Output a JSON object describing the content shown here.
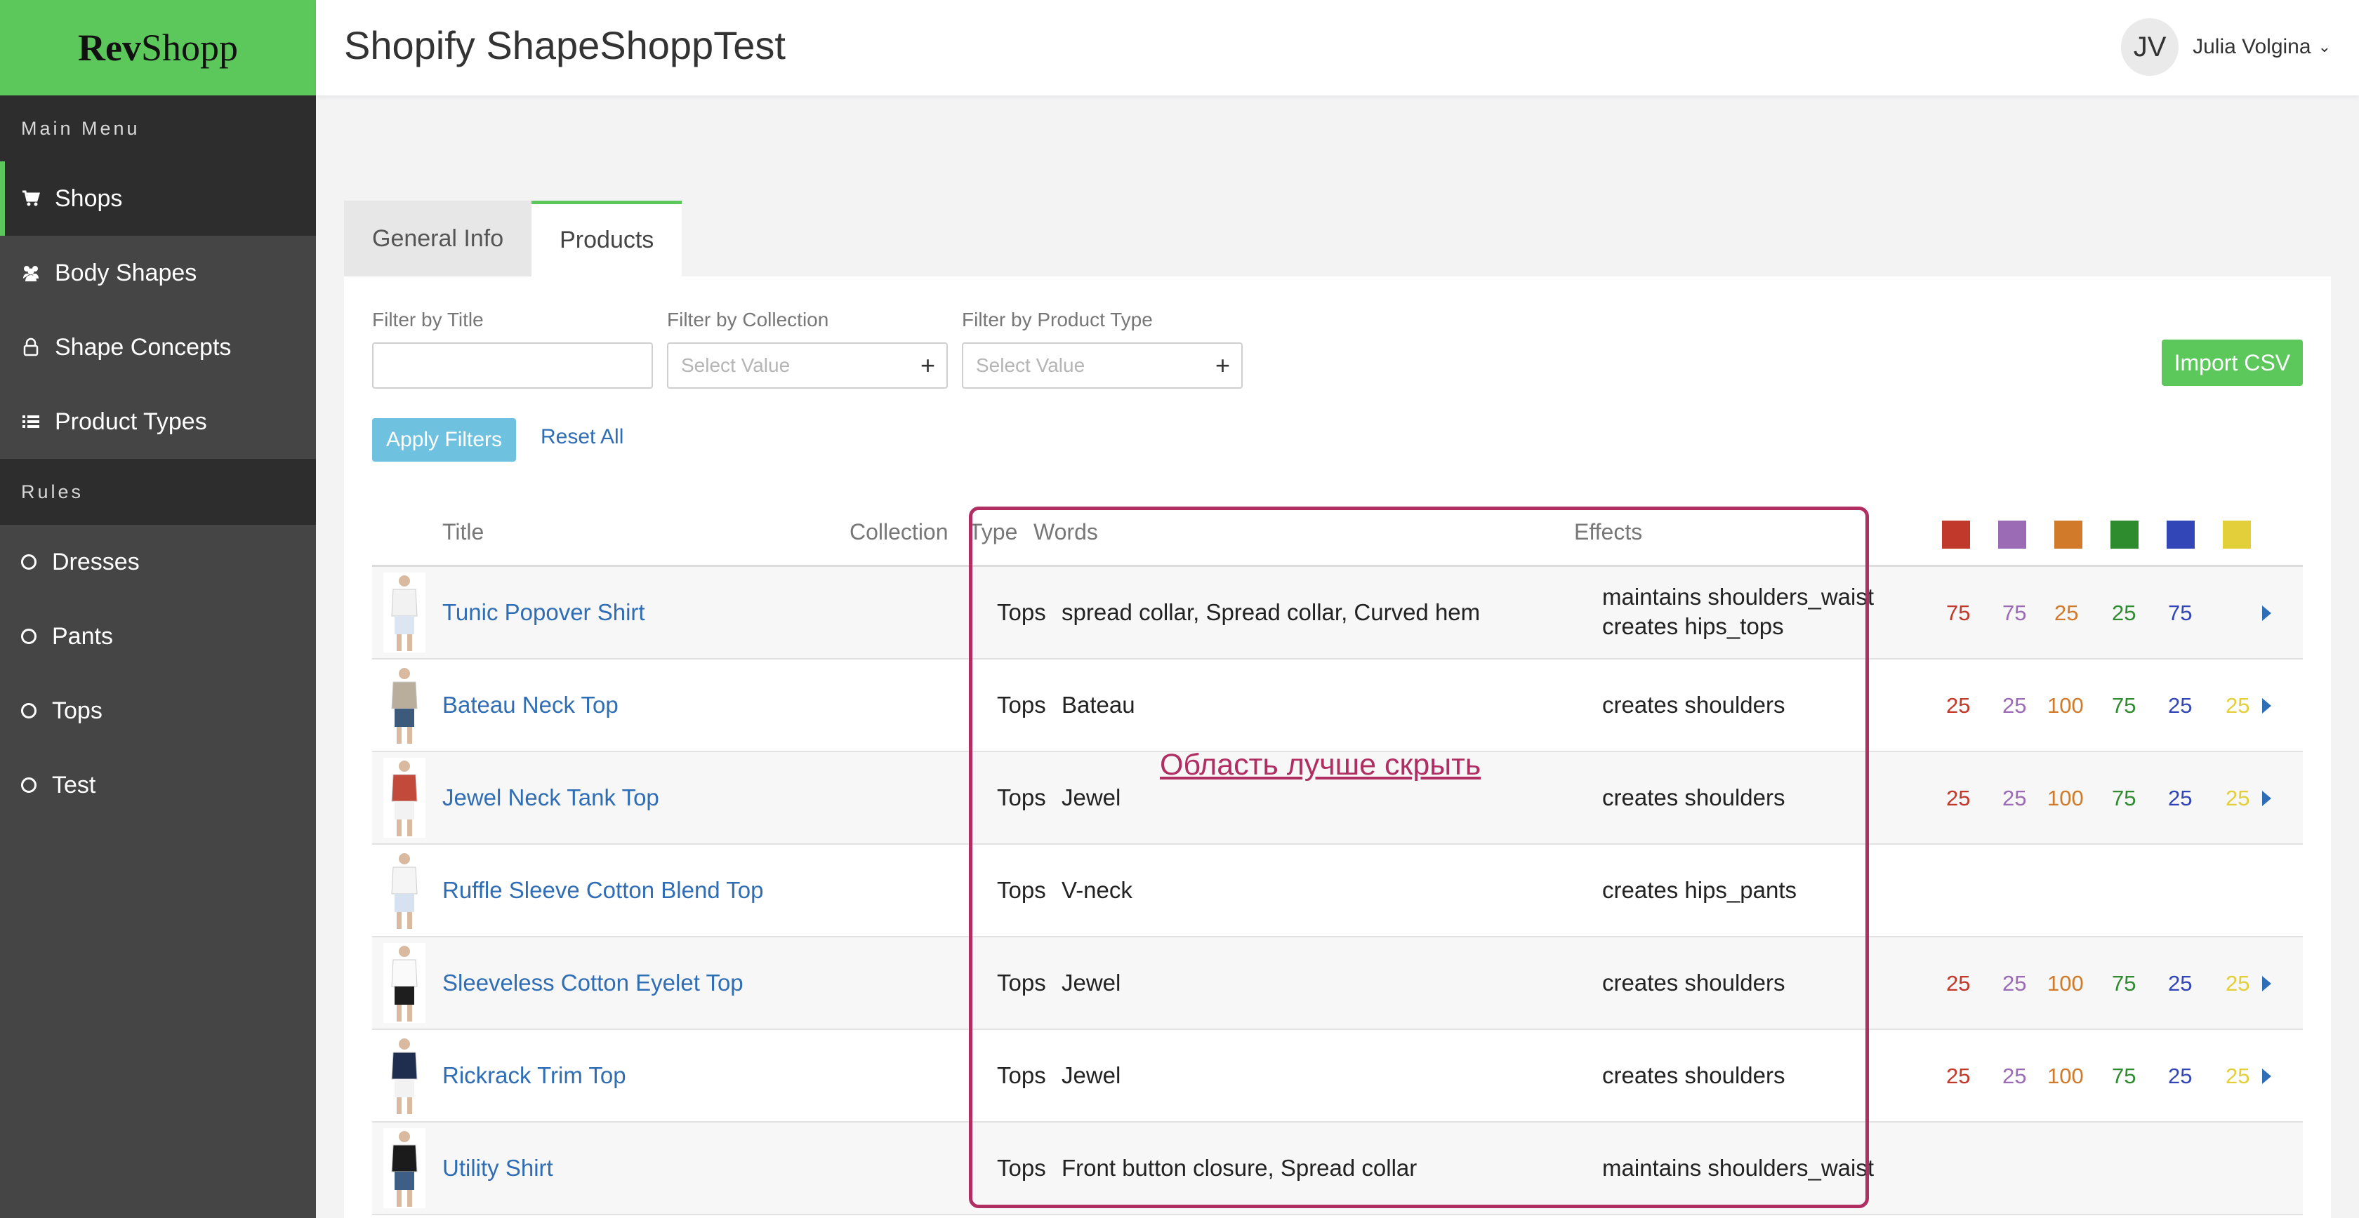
{
  "app": {
    "logo_bold": "Rev",
    "logo_light": "Shopp"
  },
  "header": {
    "title": "Shopify ShapeShoppTest",
    "user_initials": "JV",
    "user_name": "Julia Volgina"
  },
  "sidebar": {
    "main_menu_label": "Main Menu",
    "main_items": [
      {
        "label": "Shops",
        "icon": "cart-icon",
        "active": true
      },
      {
        "label": "Body Shapes",
        "icon": "users-icon",
        "active": false
      },
      {
        "label": "Shape Concepts",
        "icon": "lock-icon",
        "active": false
      },
      {
        "label": "Product Types",
        "icon": "list-icon",
        "active": false
      }
    ],
    "rules_label": "Rules",
    "rule_items": [
      {
        "label": "Dresses"
      },
      {
        "label": "Pants"
      },
      {
        "label": "Tops"
      },
      {
        "label": "Test"
      }
    ]
  },
  "tabs": [
    {
      "label": "General Info",
      "active": false
    },
    {
      "label": "Products",
      "active": true
    }
  ],
  "filters": {
    "title_label": "Filter by Title",
    "title_value": "",
    "collection_label": "Filter by Collection",
    "collection_placeholder": "Select Value",
    "type_label": "Filter by Product Type",
    "type_placeholder": "Select Value",
    "apply_label": "Apply Filters",
    "reset_label": "Reset All",
    "import_label": "Import CSV"
  },
  "table": {
    "headers": {
      "title": "Title",
      "collection": "Collection",
      "type": "Type",
      "words": "Words",
      "effects": "Effects"
    },
    "score_colors": [
      "#c0392b",
      "#9b6bb5",
      "#d07a2a",
      "#2e8b2e",
      "#3346b8",
      "#e2cf3a"
    ],
    "rows": [
      {
        "title": "Tunic Popover Shirt",
        "type": "Tops",
        "words": "spread collar, Spread collar, Curved hem",
        "effects": [
          "maintains shoulders_waist",
          "creates hips_tops"
        ],
        "scores": [
          "75",
          "75",
          "25",
          "25",
          "75",
          ""
        ],
        "arrow": true,
        "thumb": "white-shirt"
      },
      {
        "title": "Bateau Neck Top",
        "type": "Tops",
        "words": "Bateau",
        "effects": [
          "creates shoulders"
        ],
        "scores": [
          "25",
          "25",
          "100",
          "75",
          "25",
          "25"
        ],
        "arrow": true,
        "thumb": "striped-top"
      },
      {
        "title": "Jewel Neck Tank Top",
        "type": "Tops",
        "words": "Jewel",
        "effects": [
          "creates shoulders"
        ],
        "scores": [
          "25",
          "25",
          "100",
          "75",
          "25",
          "25"
        ],
        "arrow": true,
        "thumb": "tank-top"
      },
      {
        "title": "Ruffle Sleeve Cotton Blend Top",
        "type": "Tops",
        "words": "V-neck",
        "effects": [
          "creates hips_pants"
        ],
        "scores": [
          "",
          "",
          "",
          "",
          "",
          ""
        ],
        "arrow": false,
        "thumb": "white-top"
      },
      {
        "title": "Sleeveless Cotton Eyelet Top",
        "type": "Tops",
        "words": "Jewel",
        "effects": [
          "creates shoulders"
        ],
        "scores": [
          "25",
          "25",
          "100",
          "75",
          "25",
          "25"
        ],
        "arrow": true,
        "thumb": "eyelet-top"
      },
      {
        "title": "Rickrack Trim Top",
        "type": "Tops",
        "words": "Jewel",
        "effects": [
          "creates shoulders"
        ],
        "scores": [
          "25",
          "25",
          "100",
          "75",
          "25",
          "25"
        ],
        "arrow": true,
        "thumb": "navy-top"
      },
      {
        "title": "Utility Shirt",
        "type": "Tops",
        "words": "Front button closure, Spread collar",
        "effects": [
          "maintains shoulders_waist"
        ],
        "scores": [
          "",
          "",
          "",
          "",
          "",
          ""
        ],
        "arrow": false,
        "thumb": "black-shirt"
      }
    ]
  },
  "annotation": {
    "text": "Область лучше скрыть",
    "color": "#b02e62"
  }
}
